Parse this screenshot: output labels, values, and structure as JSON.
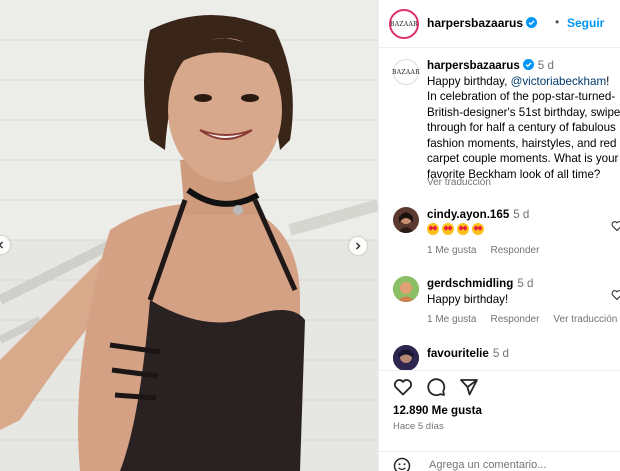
{
  "post": {
    "account": {
      "username": "harpersbazaarus",
      "avatar_text": "BAZAAR",
      "follow_label": "Seguir",
      "separator": "•"
    },
    "caption": {
      "username": "harpersbazaarus",
      "time": "5 d",
      "text_before": "Happy birthday, ",
      "mention": "@victoriabeckham",
      "text_after": "! In celebration of the pop-star-turned-British-designer's 51st birthday, swipe through for half a century of fabulous fashion moments, hairstyles, and red carpet couple moments. What is your favorite Beckham look of all time?",
      "see_translation": "Ver traducción"
    },
    "comments": [
      {
        "username": "cindy.ayon.165",
        "time": "5 d",
        "text": "",
        "emoji_count": 4,
        "emoji_name": "heart-eyes-emoji",
        "meta": [
          "1 Me gusta",
          "Responder"
        ]
      },
      {
        "username": "gerdschmidling",
        "time": "5 d",
        "text": "Happy birthday!",
        "meta": [
          "1 Me gusta",
          "Responder",
          "Ver traducción"
        ]
      },
      {
        "username": "favouritelie",
        "time": "5 d",
        "text": "",
        "meta": []
      }
    ],
    "likes": "12.890 Me gusta",
    "posted_ago": "Hace 5 días",
    "add_comment_placeholder": "Agrega un comentario..."
  },
  "icons": {
    "prev": "chevron-left-icon",
    "next": "chevron-right-icon",
    "like": "heart-icon",
    "comment": "comment-icon",
    "share": "paper-plane-icon",
    "verified": "verified-badge-icon",
    "emoji": "smiley-icon"
  },
  "colors": {
    "link": "#0095f6",
    "mention": "#00376b",
    "muted": "#737373",
    "verified": "#0095f6"
  }
}
